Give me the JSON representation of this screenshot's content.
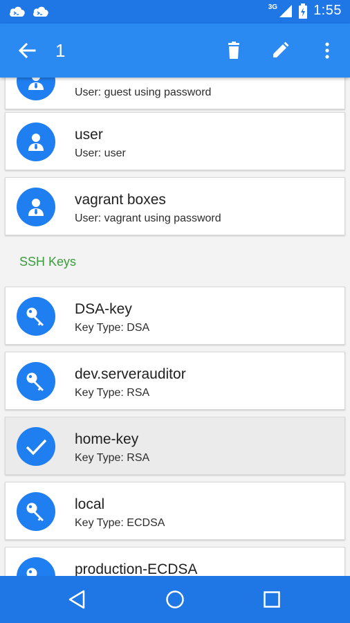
{
  "status_bar": {
    "network": "3G",
    "time": "1:55"
  },
  "app_bar": {
    "selection_count": "1"
  },
  "hosts": [
    {
      "title": "",
      "subtitle": "User: guest using password"
    },
    {
      "title": "user",
      "subtitle": "User: user"
    },
    {
      "title": "vagrant boxes",
      "subtitle": "User: vagrant using password"
    }
  ],
  "section_ssh_keys": "SSH Keys",
  "keys": [
    {
      "title": "DSA-key",
      "subtitle": "Key Type: DSA"
    },
    {
      "title": "dev.serverauditor",
      "subtitle": "Key Type: RSA"
    },
    {
      "title": "home-key",
      "subtitle": "Key Type: RSA",
      "selected": true
    },
    {
      "title": "local",
      "subtitle": "Key Type: ECDSA"
    },
    {
      "title": "production-ECDSA",
      "subtitle": ""
    }
  ],
  "colors": {
    "primary": "#2b89f2",
    "status": "#1f76e5",
    "accent": "#3a9c3a",
    "avatar": "#1f7ef0"
  }
}
